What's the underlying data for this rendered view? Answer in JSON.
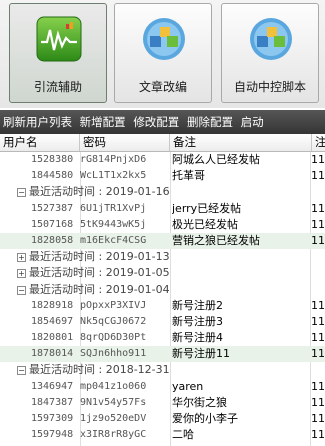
{
  "buttons": [
    {
      "label": "引流辅助",
      "icon": "chart-wave-icon"
    },
    {
      "label": "文章改编",
      "icon": "cubes-icon"
    },
    {
      "label": "自动中控脚本",
      "icon": "cubes-icon"
    }
  ],
  "toolbar": [
    "刷新用户列表",
    "新增配置",
    "修改配置",
    "删除配置",
    "启动"
  ],
  "columns": [
    "用户名",
    "密码",
    "备注",
    "注"
  ],
  "rows": [
    {
      "type": "row",
      "id": "1528380",
      "pw": "rG814PnjxD6",
      "note": "阿城么人已经发帖",
      "ext": "11",
      "alt": false
    },
    {
      "type": "row",
      "id": "1844580",
      "pw": "WcL1T1x2kx5",
      "note": "托革哥",
      "ext": "11",
      "alt": false
    },
    {
      "type": "group",
      "label": "最近活动时间 : 2019-01-16",
      "toggle": "−"
    },
    {
      "type": "row",
      "id": "1527387",
      "pw": "6U1jTR1XvPj",
      "note": "jerry已经发帖",
      "ext": "11",
      "alt": false
    },
    {
      "type": "row",
      "id": "1507168",
      "pw": "5tK9443wK5j",
      "note": "极光已经发帖",
      "ext": "11",
      "alt": false
    },
    {
      "type": "row",
      "id": "1828058",
      "pw": "m16EkcF4CSG",
      "note": "营销之狼已经发帖",
      "ext": "11",
      "alt": true
    },
    {
      "type": "group",
      "label": "最近活动时间 : 2019-01-13",
      "toggle": "+"
    },
    {
      "type": "group",
      "label": "最近活动时间 : 2019-01-05",
      "toggle": "+"
    },
    {
      "type": "group",
      "label": "最近活动时间 : 2019-01-04",
      "toggle": "−"
    },
    {
      "type": "row",
      "id": "1828918",
      "pw": "pOpxxP3XIVJ",
      "note": "新号注册2",
      "ext": "11",
      "alt": false
    },
    {
      "type": "row",
      "id": "1854697",
      "pw": "Nk5qCGJ0672",
      "note": "新号注册3",
      "ext": "11",
      "alt": false
    },
    {
      "type": "row",
      "id": "1820801",
      "pw": "8qrQD6D30Pt",
      "note": "新号注册4",
      "ext": "11",
      "alt": false
    },
    {
      "type": "row",
      "id": "1878014",
      "pw": "SQJn6hho911",
      "note": "新号注册11",
      "ext": "11",
      "alt": true
    },
    {
      "type": "group",
      "label": "最近活动时间 : 2018-12-31",
      "toggle": "−"
    },
    {
      "type": "row",
      "id": "1346947",
      "pw": "mp041z1o060",
      "note": "yaren",
      "ext": "11",
      "alt": false
    },
    {
      "type": "row",
      "id": "1847387",
      "pw": "9N1v54y57Fs",
      "note": "华尔街之狼",
      "ext": "11",
      "alt": false
    },
    {
      "type": "row",
      "id": "1597309",
      "pw": "1jz9o520eDV",
      "note": "爱你的小李子",
      "ext": "11",
      "alt": false
    },
    {
      "type": "row",
      "id": "1597948",
      "pw": "x3IR8rR8yGC",
      "note": "二哈",
      "ext": "11",
      "alt": false
    }
  ]
}
